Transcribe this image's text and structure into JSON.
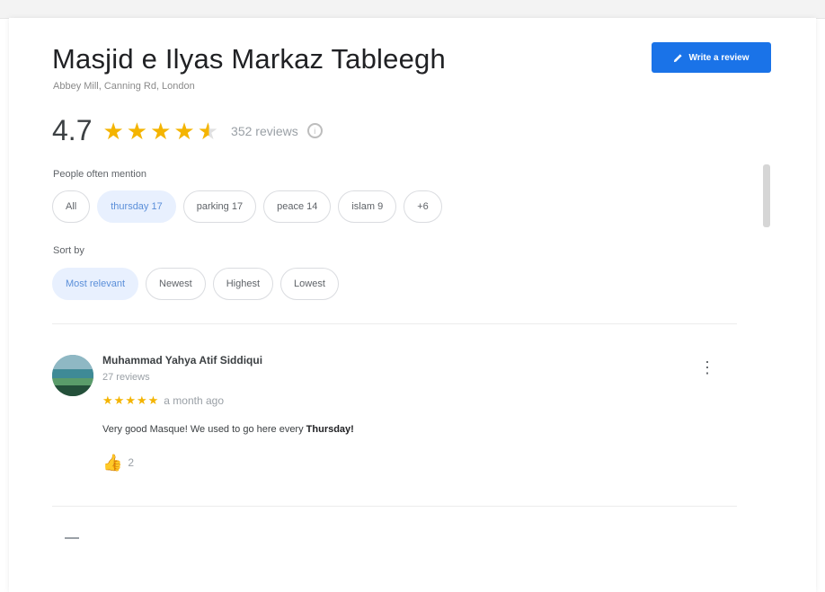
{
  "place": {
    "title": "Masjid e Ilyas Markaz Tableegh",
    "address": "Abbey Mill, Canning Rd, London"
  },
  "write_review": {
    "label": "Write a review",
    "icon": "pencil-icon"
  },
  "summary": {
    "rating": "4.7",
    "stars": 4.5,
    "review_count": "352 reviews"
  },
  "mentions": {
    "label": "People often mention",
    "chips": [
      {
        "label": "All",
        "active": false
      },
      {
        "label": "thursday  17",
        "active": true
      },
      {
        "label": "parking  17",
        "active": false
      },
      {
        "label": "peace  14",
        "active": false
      },
      {
        "label": "islam  9",
        "active": false
      },
      {
        "label": "+6",
        "active": false
      }
    ]
  },
  "sort": {
    "label": "Sort by",
    "options": [
      {
        "label": "Most relevant",
        "active": true
      },
      {
        "label": "Newest",
        "active": false
      },
      {
        "label": "Highest",
        "active": false
      },
      {
        "label": "Lowest",
        "active": false
      }
    ]
  },
  "review": {
    "name": "Muhammad Yahya Atif Siddiqui",
    "meta": "27 reviews",
    "stars": 5,
    "date": "a month ago",
    "text_before": "Very good Masque! We used to go here every ",
    "text_bold": "Thursday!",
    "likes": "2"
  },
  "colors": {
    "accent": "#1a73e8",
    "star": "#f4b400",
    "chip_active_bg": "#e8f0fe"
  }
}
